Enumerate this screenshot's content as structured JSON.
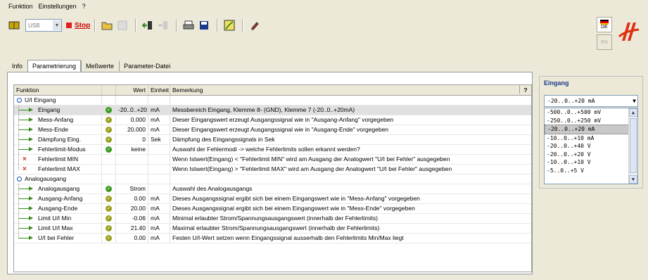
{
  "menu": [
    "Funktion",
    "Einstellungen",
    "?"
  ],
  "toolbar": {
    "port_value": "USB",
    "stop_label": "Stop"
  },
  "lang": {
    "de": "DE",
    "en": "EN"
  },
  "tabs": [
    "Info",
    "Parametrierung",
    "Meßwerte",
    "Parameter-Datei"
  ],
  "grid": {
    "headers": {
      "funktion": "Funktion",
      "wert": "Wert",
      "einheit": "Einheit",
      "bemerkung": "Bemerkung",
      "help": "?"
    },
    "group1": "U/I Eingang",
    "group2": "Analogausgang",
    "rows1": [
      {
        "name": "Eingang",
        "wert": "-20..0..+20",
        "einheit": "mA",
        "bemerkung": "Messbereich Eingang, Klemme 8- (GND),   Klemme 7  (-20..0..+20mA)"
      },
      {
        "name": "Mess-Anfang",
        "wert": "0.000",
        "einheit": "mA",
        "bemerkung": "Dieser Eingangswert erzeugt Ausgangssignal wie in \"Ausgang-Anfang\" vorgegeben"
      },
      {
        "name": "Mess-Ende",
        "wert": "20.000",
        "einheit": "mA",
        "bemerkung": "Dieser Eingangswert erzeugt Ausgangssignal wie in \"Ausgang-Ende\" vorgegeben"
      },
      {
        "name": "Dämpfung Eing.",
        "wert": "0",
        "einheit": "Sek",
        "bemerkung": "Dämpfung des Eingangssignals in Sek"
      },
      {
        "name": "Fehlerlimit-Modus",
        "wert": "keine",
        "einheit": "",
        "bemerkung": "Auswahl der Fehlermodi -> welche Fehlerlimits sollen erkannt werden?"
      },
      {
        "name": "Fehlerlimit MIN",
        "wert": "",
        "einheit": "",
        "bemerkung": "Wenn Istwert(Eingang) < \"Fehlerlimit MIN\" wird am Ausgang der Analogwert \"U/I bei Fehler\" ausgegeben"
      },
      {
        "name": "Fehlerlimit MAX",
        "wert": "",
        "einheit": "",
        "bemerkung": "Wenn Istwert(Eingang) > \"Fehlerlimit MAX\" wird am Ausgang der Analogwert \"U/I bei Fehler\" ausgegeben"
      }
    ],
    "rows2": [
      {
        "name": "Analogausgang",
        "wert": "Strom",
        "einheit": "",
        "bemerkung": "Auswahl des Analogausgangs"
      },
      {
        "name": "Ausgang-Anfang",
        "wert": "0.00",
        "einheit": "mA",
        "bemerkung": "Dieses Ausgangssignal ergibt sich bei einem Eingangswert wie in \"Mess-Anfang\" vorgegeben"
      },
      {
        "name": "Ausgang-Ende",
        "wert": "20.00",
        "einheit": "mA",
        "bemerkung": "Dieses Ausgangssignal ergibt sich bei einem Eingangswert wie in \"Mess-Ende\" vorgegeben"
      },
      {
        "name": "Limit U/I Min",
        "wert": "-0.06",
        "einheit": "mA",
        "bemerkung": "Minimal erlaubter Strom/Spannungsausgangswert (innerhalb der Fehlerlimits)"
      },
      {
        "name": "Limit U/I Max",
        "wert": "21.40",
        "einheit": "mA",
        "bemerkung": "Maximal erlaubter Strom/Spannungsausgangswert (innerhalb der Fehlerlimits)"
      },
      {
        "name": "U/I bei Fehler",
        "wert": "0.00",
        "einheit": "mA",
        "bemerkung": "Festen U/I-Wert setzen wenn Eingangssignal ausserhalb den Fehlerlimits Min/Max liegt"
      }
    ]
  },
  "side": {
    "title": "Eingang",
    "selected": "-20..0..+20 mA",
    "options": [
      "-500..0..+500 mV",
      "-250..0..+250 mV",
      "-20..0..+20 mA",
      "-10..0..+10 mA",
      "-20..0..+40 V",
      "-20..0..+20 V",
      "-10..0..+10 V",
      "-5..0..+5 V"
    ]
  },
  "colors": {
    "ok_green": "#3a9a1e",
    "ok_olive": "#9aa01e",
    "stop_red": "#e02020",
    "error_x": "#d03020"
  }
}
